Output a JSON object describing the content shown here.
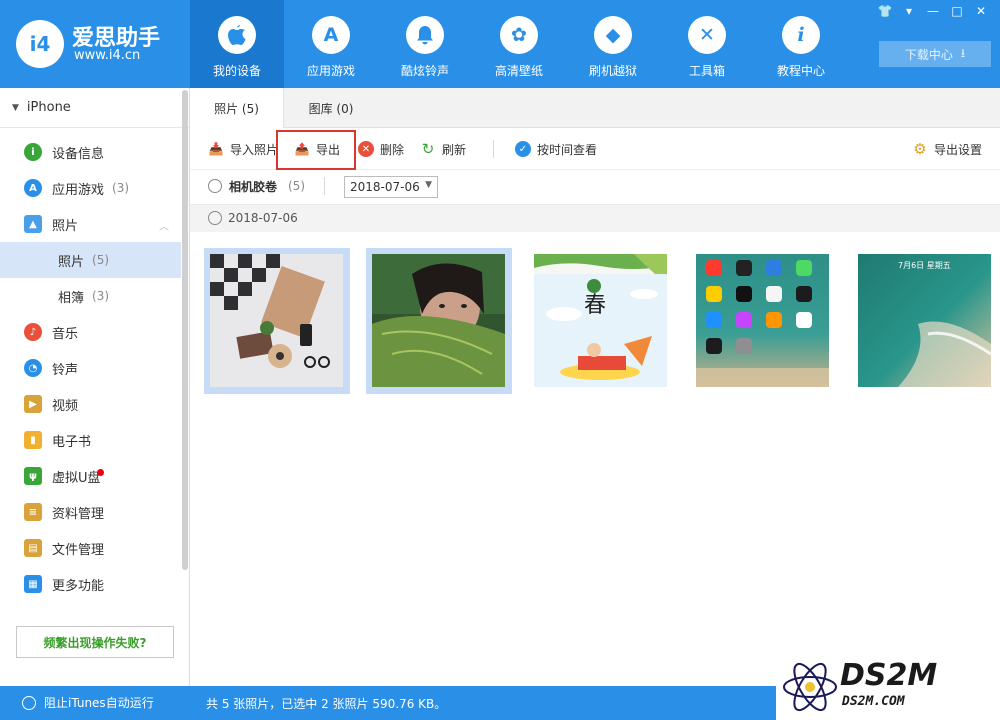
{
  "app": {
    "name": "爱思助手",
    "url": "www.i4.cn",
    "logo_text": "i4"
  },
  "nav": [
    {
      "label": "我的设备",
      "icon": "apple-icon",
      "glyph": "",
      "active": true
    },
    {
      "label": "应用游戏",
      "icon": "appstore-icon",
      "glyph": "A",
      "active": false
    },
    {
      "label": "酷炫铃声",
      "icon": "bell-icon",
      "glyph": "♪",
      "active": false
    },
    {
      "label": "高清壁纸",
      "icon": "flower-icon",
      "glyph": "✿",
      "active": false
    },
    {
      "label": "刷机越狱",
      "icon": "dropbox-icon",
      "glyph": "◆",
      "active": false
    },
    {
      "label": "工具箱",
      "icon": "tools-icon",
      "glyph": "✕",
      "active": false
    },
    {
      "label": "教程中心",
      "icon": "info-icon",
      "glyph": "i",
      "active": false
    }
  ],
  "window_controls": [
    "shirt-icon",
    "menu-icon",
    "minimize-icon",
    "maximize-icon",
    "close-icon"
  ],
  "download_center": "下载中心",
  "sidebar": {
    "device": "iPhone",
    "items": [
      {
        "label": "设备信息",
        "count": "",
        "icon": "info-icon",
        "color": "#3aa63a"
      },
      {
        "label": "应用游戏",
        "count": "(3)",
        "icon": "appstore-icon",
        "color": "#2a8fe6"
      },
      {
        "label": "照片",
        "count": "",
        "icon": "photo-icon",
        "color": "#4aa0e8"
      },
      {
        "label": "照片",
        "count": "(5)",
        "icon": "",
        "color": "",
        "sub": true,
        "active": true
      },
      {
        "label": "相簿",
        "count": "(3)",
        "icon": "",
        "color": "",
        "sub": true
      },
      {
        "label": "音乐",
        "count": "",
        "icon": "music-icon",
        "color": "#e8503a"
      },
      {
        "label": "铃声",
        "count": "",
        "icon": "bell-icon",
        "color": "#2a8fe6"
      },
      {
        "label": "视频",
        "count": "",
        "icon": "video-icon",
        "color": "#d9a23a"
      },
      {
        "label": "电子书",
        "count": "",
        "icon": "book-icon",
        "color": "#f0b030"
      },
      {
        "label": "虚拟U盘",
        "count": "",
        "icon": "usb-icon",
        "color": "#3aa63a"
      },
      {
        "label": "资料管理",
        "count": "",
        "icon": "document-icon",
        "color": "#d9a23a"
      },
      {
        "label": "文件管理",
        "count": "",
        "icon": "file-icon",
        "color": "#d9a23a"
      },
      {
        "label": "更多功能",
        "count": "",
        "icon": "grid-icon",
        "color": "#2a8fe6"
      }
    ],
    "fail_button": "频繁出现操作失败?"
  },
  "tabs": [
    {
      "label": "照片 (5)",
      "active": true
    },
    {
      "label": "图库 (0)",
      "active": false
    }
  ],
  "toolbar": {
    "import": "导入照片",
    "export": "导出",
    "delete": "删除",
    "refresh": "刷新",
    "by_time": "按时间查看",
    "export_settings": "导出设置"
  },
  "filter": {
    "album": "相机胶卷",
    "album_count": "(5)",
    "date": "2018-07-06"
  },
  "group_date": "2018-07-06",
  "photos": [
    {
      "name": "flatlay-photo",
      "selected": true
    },
    {
      "name": "leaf-portrait-photo",
      "selected": true
    },
    {
      "name": "illustration-photo",
      "selected": false,
      "caption": "春"
    },
    {
      "name": "homescreen-photo",
      "selected": false
    },
    {
      "name": "lockscreen-photo",
      "selected": false,
      "caption": "7月6日 星期五"
    }
  ],
  "status": {
    "itunes": "阻止iTunes自动运行",
    "summary": "共 5 张照片，已选中 2 张照片 590.76 KB。"
  },
  "watermark": {
    "big": "DS2M",
    "small": "DS2M.COM"
  }
}
